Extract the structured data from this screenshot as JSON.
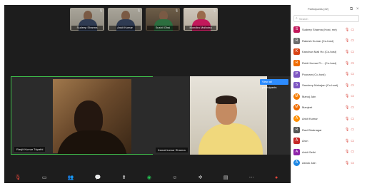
{
  "thumbnails": [
    {
      "name": "Sudeep Sharma"
    },
    {
      "name": "Ankit Kumar"
    },
    {
      "name": "Sushil Ghai"
    },
    {
      "name": "Mondira Malhotra"
    }
  ],
  "tiles": {
    "left_name": "Ranjit Kumar Tripathi",
    "right_name": "Kamal kumar Sharma",
    "view_button": "View all participants"
  },
  "toolbar": {
    "items": [
      {
        "icon": "mic-muted-icon",
        "glyph": "🎙"
      },
      {
        "icon": "video-icon",
        "glyph": "▭"
      },
      {
        "icon": "participants-icon",
        "glyph": "👥"
      },
      {
        "icon": "chat-icon",
        "glyph": "💬"
      },
      {
        "icon": "share-screen-icon",
        "glyph": "⬆"
      },
      {
        "icon": "record-icon",
        "glyph": "◉"
      },
      {
        "icon": "reactions-icon",
        "glyph": "☺"
      },
      {
        "icon": "apps-icon",
        "glyph": "✲"
      },
      {
        "icon": "whiteboard-icon",
        "glyph": "▤"
      },
      {
        "icon": "more-icon",
        "glyph": "⋯"
      },
      {
        "icon": "end-icon",
        "glyph": "●"
      }
    ]
  },
  "panel": {
    "title": "Participants (22)",
    "search_placeholder": "Search",
    "participants": [
      {
        "name": "Sudeep Sharma (Host, me)",
        "color": "#c2185b",
        "initial": "S",
        "shape": "square"
      },
      {
        "name": "Rakesh Kumar (Co-host)",
        "color": "#6d6d6d",
        "initial": "R",
        "shape": "photo"
      },
      {
        "name": "Kanchan Mali Ho (Co-host)",
        "color": "#d84315",
        "initial": "K",
        "shape": "square"
      },
      {
        "name": "Rohit Kumar Pr... (Co-host)",
        "color": "#ef6c00",
        "initial": "R",
        "shape": "square"
      },
      {
        "name": "Poonam (Co-host)",
        "color": "#7e57c2",
        "initial": "P",
        "shape": "square"
      },
      {
        "name": "Sandeep Mahajan (Co-host)",
        "color": "#7e57c2",
        "initial": "S",
        "shape": "square"
      },
      {
        "name": "Manoj Jain",
        "color": "#f57c00",
        "initial": "M",
        "shape": "circle"
      },
      {
        "name": "Manjeet",
        "color": "#ef6c00",
        "initial": "M",
        "shape": "circle"
      },
      {
        "name": "Ankit Kumar",
        "color": "#ff8f00",
        "initial": "A",
        "shape": "circle"
      },
      {
        "name": "Ravi Bhatnagar",
        "color": "#555555",
        "initial": "R",
        "shape": "photo"
      },
      {
        "name": "Arun",
        "color": "#c62828",
        "initial": "A",
        "shape": "square"
      },
      {
        "name": "Ankit Sethi",
        "color": "#8e24aa",
        "initial": "A",
        "shape": "square"
      },
      {
        "name": "Ashok Jain",
        "color": "#1e88e5",
        "initial": "A",
        "shape": "circle"
      }
    ]
  },
  "colors": {
    "accent": "#2d8cff",
    "active_speaker_border": "#3fbf4b",
    "muted": "#d9463c"
  }
}
